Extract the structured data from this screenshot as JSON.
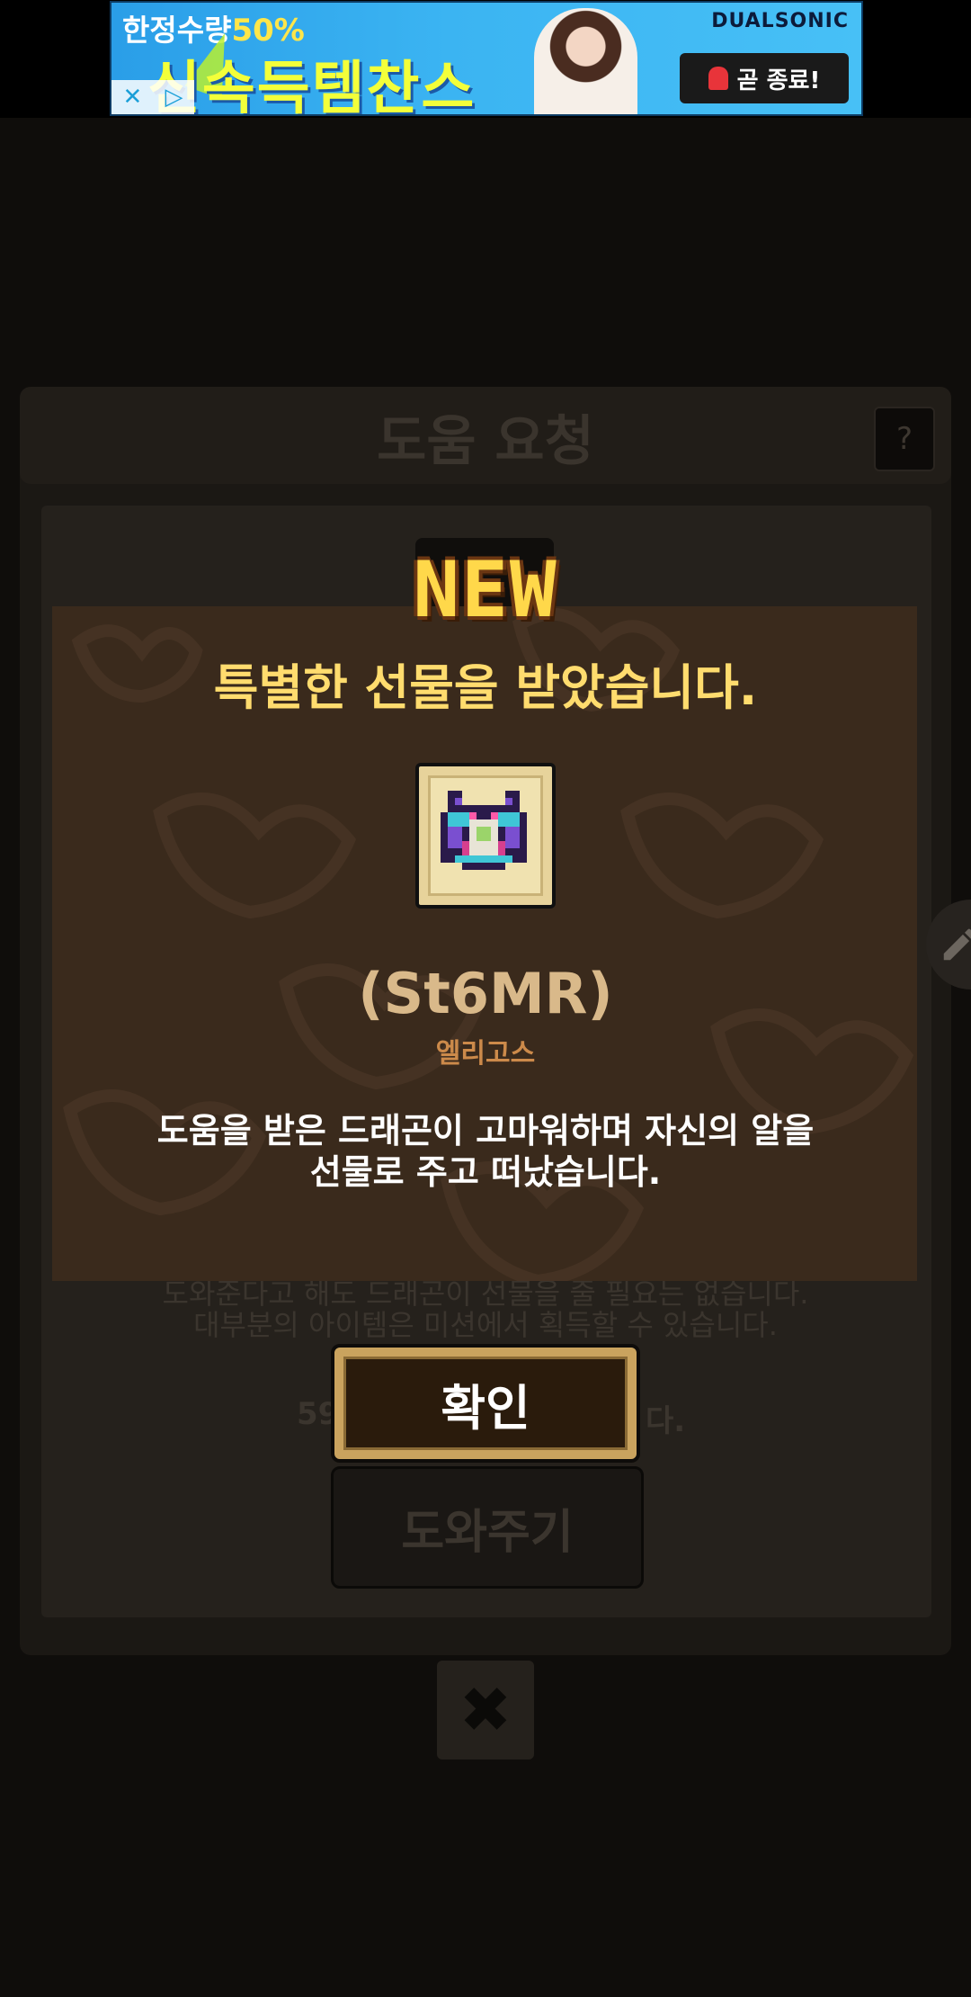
{
  "ad": {
    "top_text": "한정수량",
    "top_percent": "50%",
    "main_text": "신속득템찬스",
    "brand": "DUALSONIC",
    "cta": "곧 종료!",
    "choices_x": "✕",
    "choices_play": "▷"
  },
  "background": {
    "title": "도움 요청",
    "help_icon": "?",
    "text_line1": "도와준다고 해도 드래곤이 선물을 줄 필요는 없습니다.",
    "text_line2": "대부분의 아이템은 미션에서 획득할 수 있습니다.",
    "cost_prefix": "59",
    "cost_suffix": "다.",
    "help_button": "도와주기",
    "close_icon": "✖"
  },
  "dialog": {
    "badge": "NEW",
    "title": "특별한 선물을 받았습니다.",
    "item_name": "(St6MR)",
    "item_subtitle": "엘리고스",
    "description_line1": "도움을 받은 드래곤이 고마워하며 자신의 알을",
    "description_line2": "선물로 주고 떠났습니다.",
    "confirm_label": "확인"
  },
  "colors": {
    "dialog_bg": "#3a2a1c",
    "title_yellow": "#ffdc6e",
    "item_name": "#d9b98a",
    "item_sub": "#cc8a4a",
    "button_frame": "#caa35e"
  },
  "icons": {
    "item": "dragon-egg-icon",
    "edit": "pencil-icon"
  }
}
